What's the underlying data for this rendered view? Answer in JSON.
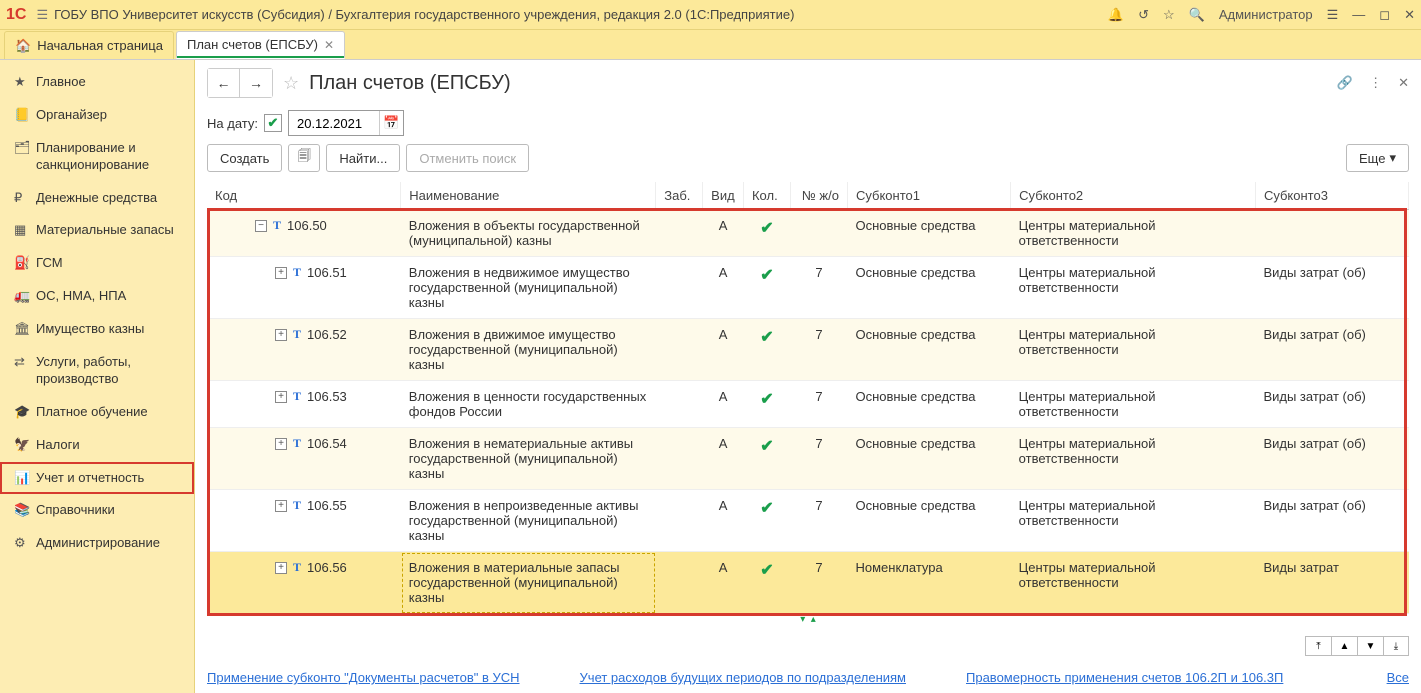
{
  "titlebar": {
    "title": "ГОБУ ВПО Университет искусств (Субсидия) / Бухгалтерия государственного учреждения, редакция 2.0  (1С:Предприятие)",
    "admin": "Администратор"
  },
  "tabs": {
    "home": "Начальная страница",
    "active": "План счетов (ЕПСБУ)"
  },
  "sidebar": {
    "items": [
      "Главное",
      "Органайзер",
      "Планирование и санкционирование",
      "Денежные средства",
      "Материальные запасы",
      "ГСМ",
      "ОС, НМА, НПА",
      "Имущество казны",
      "Услуги, работы, производство",
      "Платное обучение",
      "Налоги",
      "Учет и отчетность",
      "Справочники",
      "Администрирование"
    ],
    "selected_index": 11
  },
  "page": {
    "title": "План счетов (ЕПСБУ)",
    "date_label": "На дату:",
    "date_value": "20.12.2021"
  },
  "toolbar": {
    "create": "Создать",
    "find": "Найти...",
    "cancel_find": "Отменить поиск",
    "more": "Еще"
  },
  "columns": {
    "code": "Код",
    "name": "Наименование",
    "zab": "Заб.",
    "vid": "Вид",
    "kol": "Кол.",
    "njo": "№ ж/о",
    "sub1": "Субконто1",
    "sub2": "Субконто2",
    "sub3": "Субконто3"
  },
  "rows": [
    {
      "level": 0,
      "expand": "minus",
      "code": "106.50",
      "name": "Вложения в объекты государственной (муниципальной) казны",
      "vid": "А",
      "kol": true,
      "njo": "",
      "s1": "Основные средства",
      "s2": "Центры материальной ответственности",
      "s3": ""
    },
    {
      "level": 1,
      "expand": "plus",
      "code": "106.51",
      "name": "Вложения в недвижимое имущество государственной (муниципальной) казны",
      "vid": "А",
      "kol": true,
      "njo": "7",
      "s1": "Основные средства",
      "s2": "Центры материальной ответственности",
      "s3": "Виды затрат (об)"
    },
    {
      "level": 1,
      "expand": "plus",
      "code": "106.52",
      "name": "Вложения в движимое имущество государственной (муниципальной) казны",
      "vid": "А",
      "kol": true,
      "njo": "7",
      "s1": "Основные средства",
      "s2": "Центры материальной ответственности",
      "s3": "Виды затрат (об)"
    },
    {
      "level": 1,
      "expand": "plus",
      "code": "106.53",
      "name": "Вложения в ценности государственных фондов России",
      "vid": "А",
      "kol": true,
      "njo": "7",
      "s1": "Основные средства",
      "s2": "Центры материальной ответственности",
      "s3": "Виды затрат (об)"
    },
    {
      "level": 1,
      "expand": "plus",
      "code": "106.54",
      "name": "Вложения в нематериальные активы государственной (муниципальной) казны",
      "vid": "А",
      "kol": true,
      "njo": "7",
      "s1": "Основные средства",
      "s2": "Центры материальной ответственности",
      "s3": "Виды затрат (об)"
    },
    {
      "level": 1,
      "expand": "plus",
      "code": "106.55",
      "name": "Вложения в непроизведенные активы государственной (муниципальной) казны",
      "vid": "А",
      "kol": true,
      "njo": "7",
      "s1": "Основные средства",
      "s2": "Центры материальной ответственности",
      "s3": "Виды затрат (об)"
    },
    {
      "level": 1,
      "expand": "plus",
      "code": "106.56",
      "name": "Вложения в материальные запасы государственной (муниципальной) казны",
      "vid": "А",
      "kol": true,
      "njo": "7",
      "s1": "Номенклатура",
      "s2": "Центры материальной ответственности",
      "s3": "Виды затрат",
      "selected": true
    }
  ],
  "footer": {
    "link1": "Применение субконто \"Документы расчетов\" в УСН",
    "link2": "Учет расходов будущих периодов по подразделениям",
    "link3": "Правомерность применения счетов 106.2П и 106.3П",
    "all": "Все"
  }
}
